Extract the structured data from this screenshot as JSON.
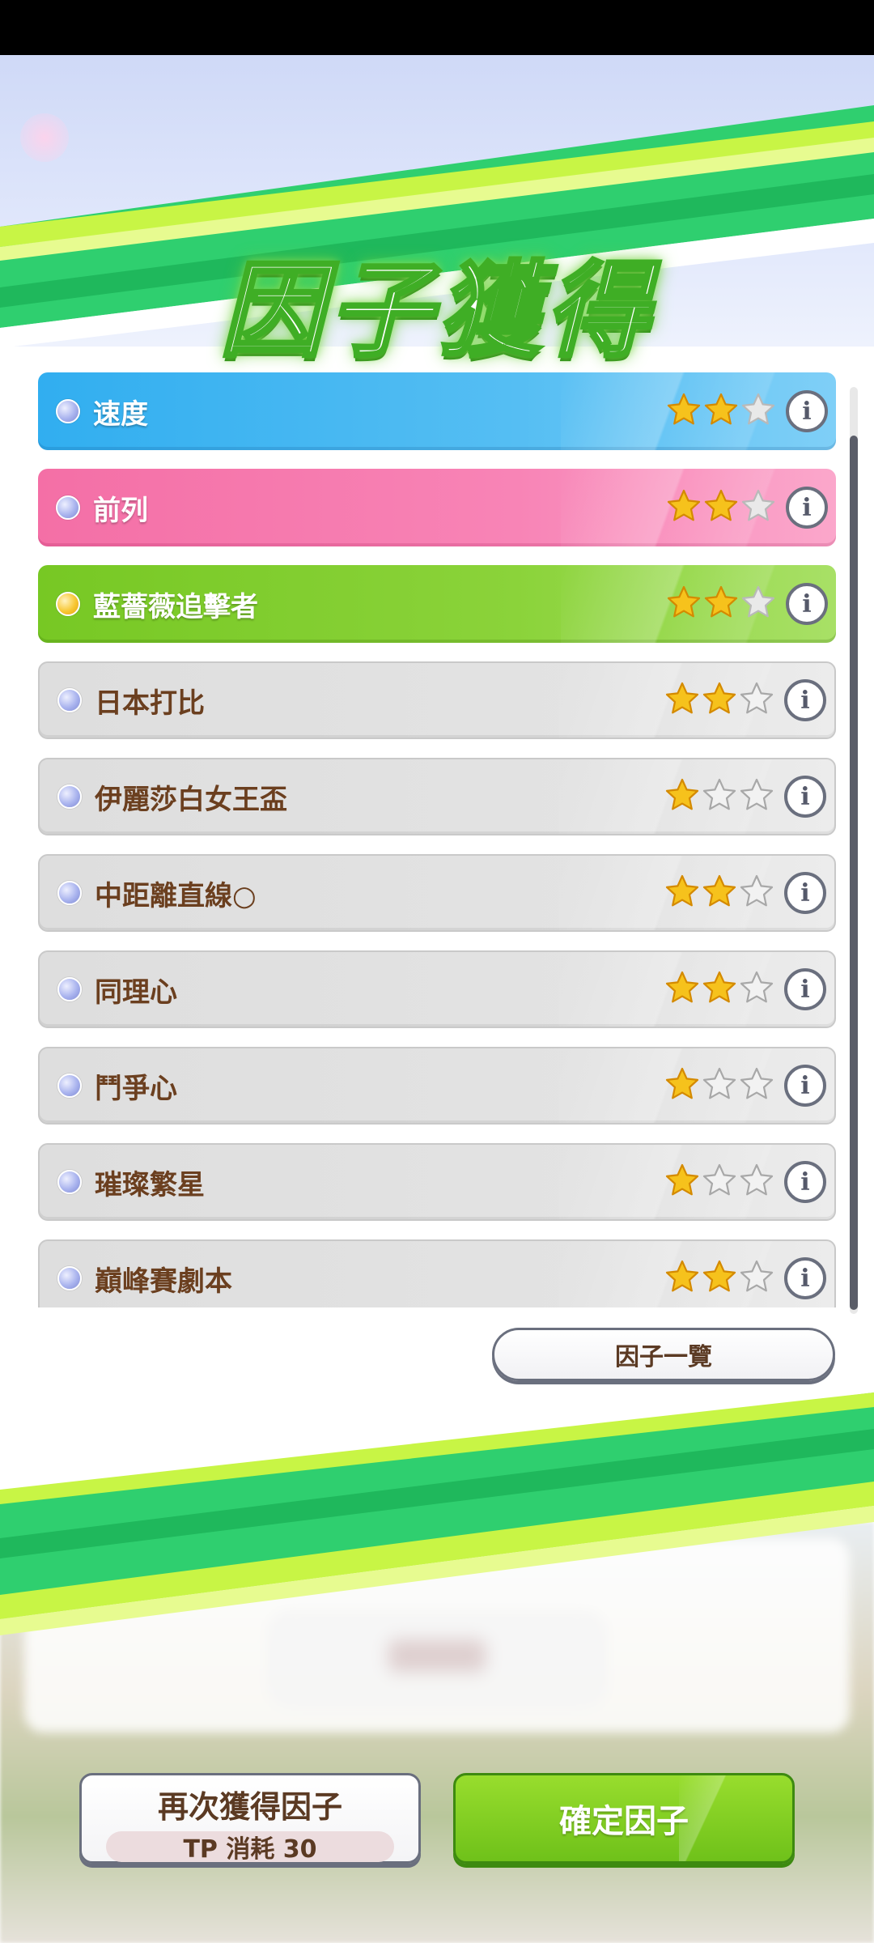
{
  "title": "因子獲得",
  "factors": [
    {
      "name": "速度",
      "stars": 2,
      "max_stars": 3,
      "color": "blue"
    },
    {
      "name": "前列",
      "stars": 2,
      "max_stars": 3,
      "color": "pink"
    },
    {
      "name": "藍薔薇追擊者",
      "stars": 2,
      "max_stars": 3,
      "color": "green"
    },
    {
      "name": "日本打比",
      "stars": 2,
      "max_stars": 3,
      "color": "gray"
    },
    {
      "name": "伊麗莎白女王盃",
      "stars": 1,
      "max_stars": 3,
      "color": "gray"
    },
    {
      "name": "中距離直線○",
      "stars": 2,
      "max_stars": 3,
      "color": "gray"
    },
    {
      "name": "同理心",
      "stars": 2,
      "max_stars": 3,
      "color": "gray"
    },
    {
      "name": "鬥爭心",
      "stars": 1,
      "max_stars": 3,
      "color": "gray"
    },
    {
      "name": "璀璨繁星",
      "stars": 1,
      "max_stars": 3,
      "color": "gray"
    },
    {
      "name": "巔峰賽劇本",
      "stars": 2,
      "max_stars": 3,
      "color": "gray"
    }
  ],
  "info_icon": "i",
  "factor_list_button": "因子一覽",
  "reacquire_button": {
    "label": "再次獲得因子",
    "cost": "TP 消耗 30"
  },
  "confirm_button": "確定因子",
  "colors": {
    "blue": "#31aef0",
    "pink": "#f46fa6",
    "green": "#77c824",
    "gray": "#dedede",
    "star_gold": "#f4b400",
    "text_brown": "#6b3f1f"
  }
}
